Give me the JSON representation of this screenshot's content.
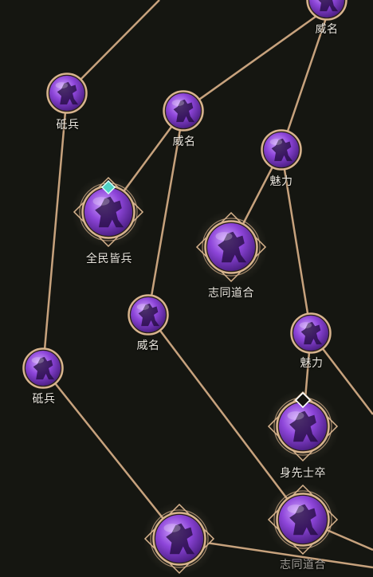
{
  "colors": {
    "background": "#151611",
    "connector": "#c7a27d",
    "ring": "#d8b48e",
    "orb_light": "#b77cf0",
    "orb_dark": "#4b1d86",
    "selected_marker": "#4fd1c5",
    "locked_marker": "#ffffff",
    "label": "#e9e5dd"
  },
  "skill_tree": {
    "nodes": [
      {
        "id": "top-right",
        "type": "minor",
        "label": "威名",
        "icon": "warrior-silhouette-icon"
      },
      {
        "id": "left-top",
        "type": "minor",
        "label": "砥兵",
        "icon": "warrior-silhouette-icon"
      },
      {
        "id": "mid-top",
        "type": "minor",
        "label": "威名",
        "icon": "warrior-silhouette-icon"
      },
      {
        "id": "right-upper",
        "type": "minor",
        "label": "魅力",
        "icon": "warrior-silhouette-icon"
      },
      {
        "id": "quanmin",
        "type": "major",
        "label": "全民皆兵",
        "icon": "warrior-silhouette-icon",
        "marker": "selected"
      },
      {
        "id": "zhitong-1",
        "type": "major",
        "label": "志同道合",
        "icon": "warrior-silhouette-icon"
      },
      {
        "id": "mid-lower",
        "type": "minor",
        "label": "威名",
        "icon": "warrior-silhouette-icon"
      },
      {
        "id": "right-mid",
        "type": "minor",
        "label": "魅力",
        "icon": "warrior-silhouette-icon"
      },
      {
        "id": "left-lower",
        "type": "minor",
        "label": "砥兵",
        "icon": "warrior-silhouette-icon"
      },
      {
        "id": "shenxian",
        "type": "major",
        "label": "身先士卒",
        "icon": "warrior-silhouette-icon",
        "marker": "locked"
      },
      {
        "id": "bottom-mid",
        "type": "major",
        "label": "",
        "icon": "warrior-silhouette-icon"
      },
      {
        "id": "zhitong-2",
        "type": "major",
        "label": "志同道合",
        "icon": "warrior-silhouette-icon"
      }
    ]
  }
}
